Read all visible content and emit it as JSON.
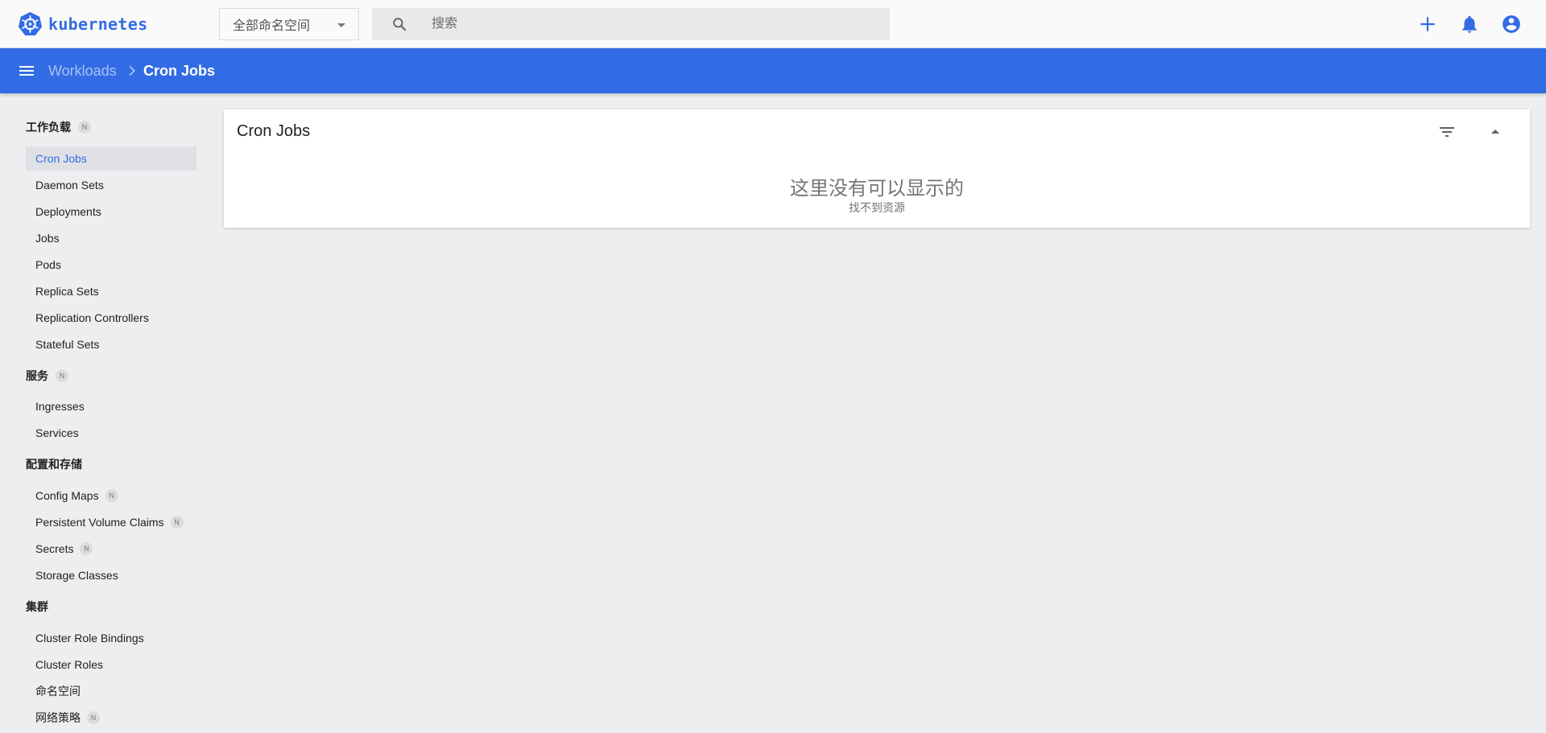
{
  "header": {
    "brand": "kubernetes",
    "namespace_select": "全部命名空间",
    "search_placeholder": "搜索",
    "icons": [
      "plus-icon",
      "bell-icon",
      "account-icon"
    ],
    "accent_color": "#326ce5"
  },
  "breadcrumb": {
    "parent": "Workloads",
    "current": "Cron Jobs"
  },
  "sidebar": {
    "sections": [
      {
        "title": "工作负载",
        "badge": "N",
        "items": [
          {
            "label": "Cron Jobs",
            "active": true
          },
          {
            "label": "Daemon Sets"
          },
          {
            "label": "Deployments"
          },
          {
            "label": "Jobs"
          },
          {
            "label": "Pods"
          },
          {
            "label": "Replica Sets"
          },
          {
            "label": "Replication Controllers"
          },
          {
            "label": "Stateful Sets"
          }
        ]
      },
      {
        "title": "服务",
        "badge": "N",
        "items": [
          {
            "label": "Ingresses"
          },
          {
            "label": "Services"
          }
        ]
      },
      {
        "title": "配置和存储",
        "items": [
          {
            "label": "Config Maps",
            "badge": "N"
          },
          {
            "label": "Persistent Volume Claims",
            "badge": "N"
          },
          {
            "label": "Secrets",
            "badge": "N"
          },
          {
            "label": "Storage Classes"
          }
        ]
      },
      {
        "title": "集群",
        "items": [
          {
            "label": "Cluster Role Bindings"
          },
          {
            "label": "Cluster Roles"
          },
          {
            "label": "命名空间"
          },
          {
            "label": "网络策略",
            "badge": "N"
          }
        ]
      }
    ]
  },
  "main": {
    "card_title": "Cron Jobs",
    "empty_title": "这里没有可以显示的",
    "empty_subtitle": "找不到资源"
  }
}
